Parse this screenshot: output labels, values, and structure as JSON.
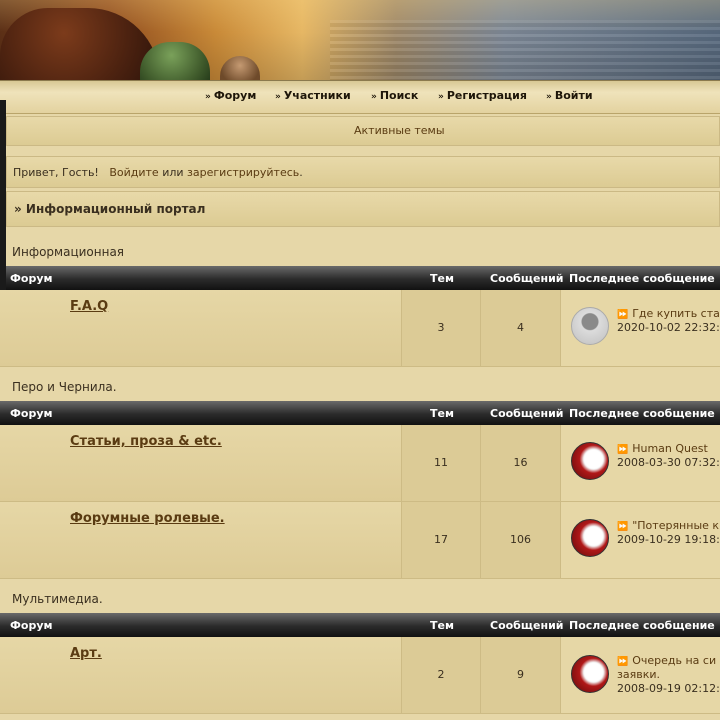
{
  "nav": {
    "items": [
      {
        "label": "Форум"
      },
      {
        "label": "Участники"
      },
      {
        "label": "Поиск"
      },
      {
        "label": "Регистрация"
      },
      {
        "label": "Войти"
      }
    ]
  },
  "active_topics": "Активные темы",
  "greeting": {
    "prefix": "Привет, Гость!",
    "login": "Войдите",
    "or": "или",
    "register": "зарегистрируйтесь",
    "suffix": "."
  },
  "portal_title": "» Информационный портал",
  "table_headers": {
    "forum": "Форум",
    "topics": "Тем",
    "posts": "Сообщений",
    "last": "Последнее сообщение"
  },
  "sections": [
    {
      "title": "Информационная",
      "forums": [
        {
          "name": "F.A.Q",
          "topics": "3",
          "posts": "4",
          "last_title": "Где купить ста",
          "last_date": "2020-10-02 22:32:",
          "avatar": "gray-user-icon"
        }
      ]
    },
    {
      "title": "Перо и Чернила.",
      "forums": [
        {
          "name": "Статьи, проза & etc.",
          "topics": "11",
          "posts": "16",
          "last_title": "Human Quest",
          "last_date": "2008-03-30 07:32:",
          "avatar": "red-avatar"
        },
        {
          "name": "Форумные ролевые.",
          "topics": "17",
          "posts": "106",
          "last_title": "\"Потерянные к",
          "last_date": "2009-10-29 19:18:",
          "avatar": "red-avatar"
        }
      ]
    },
    {
      "title": "Мультимедиа.",
      "forums": [
        {
          "name": "Арт.",
          "topics": "2",
          "posts": "9",
          "last_title": "Очередь на си",
          "last_title2": "заявки.",
          "last_date": "2008-09-19 02:12:",
          "avatar": "red-avatar"
        }
      ]
    }
  ]
}
